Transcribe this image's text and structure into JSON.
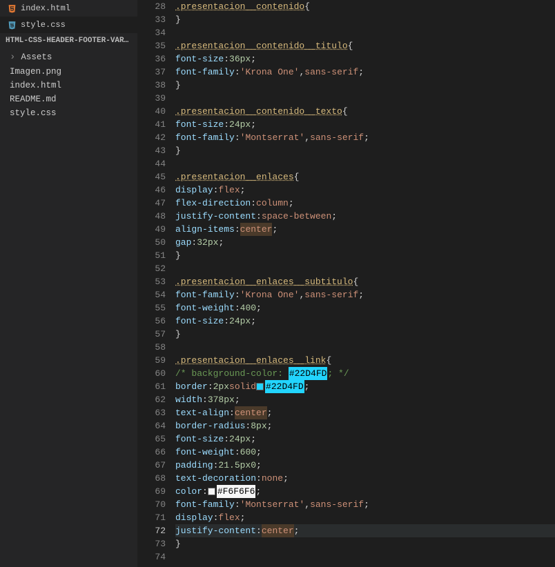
{
  "sidebar": {
    "tabs": [
      {
        "icon": "html",
        "label": "index.html"
      },
      {
        "icon": "css",
        "label": "style.css"
      }
    ],
    "folder": "HTML-CSS-HEADER-FOOTER-VARIAB...",
    "files": [
      {
        "label": "Assets",
        "chevron": true
      },
      {
        "label": "Imagen.png"
      },
      {
        "label": "index.html"
      },
      {
        "label": "README.md"
      },
      {
        "label": "style.css"
      }
    ]
  },
  "gutter": {
    "start": 28,
    "collapsed_after_first": true,
    "lines": [
      28,
      33,
      34,
      35,
      36,
      37,
      38,
      39,
      40,
      41,
      42,
      43,
      44,
      45,
      46,
      47,
      48,
      49,
      50,
      51,
      52,
      53,
      54,
      55,
      56,
      57,
      58,
      59,
      60,
      61,
      62,
      63,
      64,
      65,
      66,
      67,
      68,
      69,
      70,
      71,
      72,
      73,
      74
    ],
    "active": 72
  },
  "code": {
    "lines": [
      {
        "n": 28,
        "html": "<span class='sel'>.presentacion__contenido</span><span class='punc'>{</span>"
      },
      {
        "n": 33,
        "html": "<span class='punc'>}</span>"
      },
      {
        "n": 34,
        "html": ""
      },
      {
        "n": 35,
        "html": "<span class='sel'>.presentacion__contenido__titulo</span><span class='punc'>{</span>"
      },
      {
        "n": 36,
        "html": "    <span class='prop'>font-size</span><span class='punc'>:</span> <span class='num'>36px</span><span class='punc'>;</span>"
      },
      {
        "n": 37,
        "html": "    <span class='prop'>font-family</span><span class='punc'>:</span> <span class='str'>'Krona One'</span><span class='punc'>,</span> <span class='val'>sans-serif</span><span class='punc'>;</span>"
      },
      {
        "n": 38,
        "html": "<span class='punc'>}</span>"
      },
      {
        "n": 39,
        "html": ""
      },
      {
        "n": 40,
        "html": "<span class='sel'>.presentacion__contenido__texto</span><span class='punc'>{</span>"
      },
      {
        "n": 41,
        "html": "    <span class='prop'>font-size</span><span class='punc'>:</span> <span class='num'>24px</span><span class='punc'>;</span>"
      },
      {
        "n": 42,
        "html": "    <span class='prop'>font-family</span><span class='punc'>:</span> <span class='str'>'Montserrat'</span><span class='punc'>,</span> <span class='val'>sans-serif</span><span class='punc'>;</span>"
      },
      {
        "n": 43,
        "html": "<span class='punc'>}</span>"
      },
      {
        "n": 44,
        "html": ""
      },
      {
        "n": 45,
        "html": "<span class='sel'>.presentacion__enlaces</span><span class='punc'>{</span>"
      },
      {
        "n": 46,
        "html": "    <span class='prop'>display</span><span class='punc'>:</span> <span class='val'>flex</span><span class='punc'>;</span>"
      },
      {
        "n": 47,
        "html": "    <span class='prop'>flex-direction</span><span class='punc'>:</span> <span class='val'>column</span><span class='punc'>;</span>"
      },
      {
        "n": 48,
        "html": "    <span class='prop'>justify-content</span><span class='punc'>:</span> <span class='val'>space-between</span><span class='punc'>;</span>"
      },
      {
        "n": 49,
        "html": "    <span class='prop'>align-items</span><span class='punc'>:</span> <span class='val hl-center'>center</span><span class='punc'>;</span>"
      },
      {
        "n": 50,
        "html": "    <span class='prop'>gap</span><span class='punc'>:</span> <span class='num'>32px</span><span class='punc'>;</span>"
      },
      {
        "n": 51,
        "html": "<span class='punc'>}</span>"
      },
      {
        "n": 52,
        "html": ""
      },
      {
        "n": 53,
        "html": "<span class='sel'>.presentacion__enlaces__subtitulo</span><span class='punc'>{</span>"
      },
      {
        "n": 54,
        "html": "    <span class='prop'>font-family</span><span class='punc'>:</span> <span class='str'>'Krona One'</span><span class='punc'>,</span> <span class='val'>sans-serif</span><span class='punc'>;</span>"
      },
      {
        "n": 55,
        "html": "    <span class='prop'>font-weight</span><span class='punc'>:</span> <span class='num'>400</span><span class='punc'>;</span>"
      },
      {
        "n": 56,
        "html": "    <span class='prop'>font-size</span><span class='punc'>:</span> <span class='num'>24px</span><span class='punc'>;</span>"
      },
      {
        "n": 57,
        "html": "<span class='punc'>}</span>"
      },
      {
        "n": 58,
        "html": ""
      },
      {
        "n": 59,
        "html": "<span class='sel'>.presentacion__enlaces__link</span><span class='punc'>{</span>"
      },
      {
        "n": 60,
        "html": "     <span class='cmt'>/* background-color: </span><span class='hl-color1'>#22D4FD</span><span class='cmt'>; */</span>"
      },
      {
        "n": 61,
        "html": "     <span class='prop'>border</span><span class='punc'>:</span> <span class='num'>2px</span> <span class='val'>solid</span> <span class='swatch' style='background:#22D4FD'></span><span class='hl-color2'>#22D4FD</span><span class='punc'>;</span>"
      },
      {
        "n": 62,
        "html": "     <span class='prop'>width</span><span class='punc'>:</span> <span class='num'>378px</span><span class='punc'>;</span>"
      },
      {
        "n": 63,
        "html": "     <span class='prop'>text-align</span><span class='punc'>:</span> <span class='val hl-center'>center</span><span class='punc'>;</span>"
      },
      {
        "n": 64,
        "html": "     <span class='prop'>border-radius</span><span class='punc'>:</span> <span class='num'>8px</span><span class='punc'>;</span>"
      },
      {
        "n": 65,
        "html": "     <span class='prop'>font-size</span><span class='punc'>:</span> <span class='num'>24px</span><span class='punc'>;</span>"
      },
      {
        "n": 66,
        "html": "     <span class='prop'>font-weight</span><span class='punc'>:</span> <span class='num'>600</span><span class='punc'>;</span>"
      },
      {
        "n": 67,
        "html": "     <span class='prop'>padding</span><span class='punc'>:</span> <span class='num'>21.5px</span> <span class='num'>0</span><span class='punc'>;</span>"
      },
      {
        "n": 68,
        "html": "     <span class='prop'>text-decoration</span><span class='punc'>:</span> <span class='val'>none</span><span class='punc'>;</span>"
      },
      {
        "n": 69,
        "html": "     <span class='prop'>color</span><span class='punc'>:</span> <span class='swatch' style='background:#F6F6F6'></span><span class='hl-color3'>#F6F6F6</span><span class='punc'>;</span>"
      },
      {
        "n": 70,
        "html": "     <span class='prop'>font-family</span><span class='punc'>:</span> <span class='str'>'Montserrat'</span><span class='punc'>,</span> <span class='val'>sans-serif</span><span class='punc'>;</span>"
      },
      {
        "n": 71,
        "html": "     <span class='prop'>display</span><span class='punc'>:</span> <span class='val'>flex</span><span class='punc'>;</span>"
      },
      {
        "n": 72,
        "html": "     <span class='prop'>justify-content</span><span class='punc'>:</span> <span class='val hl-center'>center</span><span class='punc'>;</span>",
        "current": true
      },
      {
        "n": 73,
        "html": "<span class='punc'>}</span>"
      },
      {
        "n": 74,
        "html": ""
      }
    ]
  }
}
